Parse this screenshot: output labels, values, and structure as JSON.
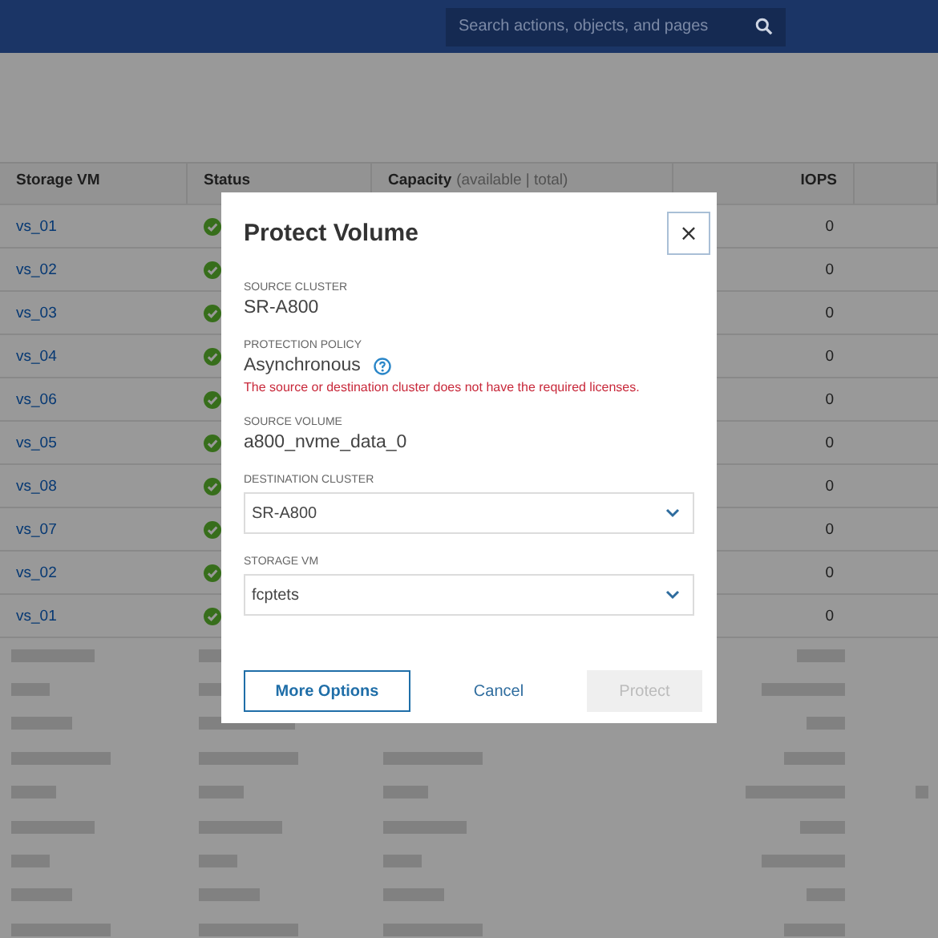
{
  "header": {
    "search": {
      "placeholder": "Search actions, objects, and pages"
    }
  },
  "table": {
    "columns": [
      {
        "label": "Storage VM"
      },
      {
        "label": "Status"
      },
      {
        "label": "Capacity",
        "note": "(available | total)"
      },
      {
        "label": "IOPS"
      }
    ],
    "rows": [
      {
        "storage_vm": "vs_01",
        "iops": "0"
      },
      {
        "storage_vm": "vs_02",
        "iops": "0"
      },
      {
        "storage_vm": "vs_03",
        "iops": "0"
      },
      {
        "storage_vm": "vs_04",
        "iops": "0"
      },
      {
        "storage_vm": "vs_06",
        "iops": "0"
      },
      {
        "storage_vm": "vs_05",
        "iops": "0"
      },
      {
        "storage_vm": "vs_08",
        "iops": "0"
      },
      {
        "storage_vm": "vs_07",
        "iops": "0"
      },
      {
        "storage_vm": "vs_02",
        "iops": "0"
      },
      {
        "storage_vm": "vs_01",
        "iops": "0"
      }
    ]
  },
  "dialog": {
    "title": "Protect Volume",
    "close": "×",
    "fields": [
      {
        "kind": "text",
        "label": "SOURCE CLUSTER",
        "value": "SR-A800"
      },
      {
        "kind": "text",
        "label": "PROTECTION POLICY",
        "value": "Asynchronous",
        "help": true,
        "error": "The source or destination cluster does not have the required licenses."
      },
      {
        "kind": "text",
        "label": "SOURCE VOLUME",
        "value": "a800_nvme_data_0"
      },
      {
        "kind": "select",
        "label": "DESTINATION CLUSTER",
        "value": "SR-A800"
      },
      {
        "kind": "select",
        "label": "STORAGE VM",
        "value": "fcptets"
      }
    ],
    "buttons": [
      {
        "label": "More Options",
        "kind": "outline"
      },
      {
        "label": "Cancel",
        "kind": "link"
      },
      {
        "label": "Protect",
        "kind": "primary",
        "disabled": true
      }
    ]
  }
}
